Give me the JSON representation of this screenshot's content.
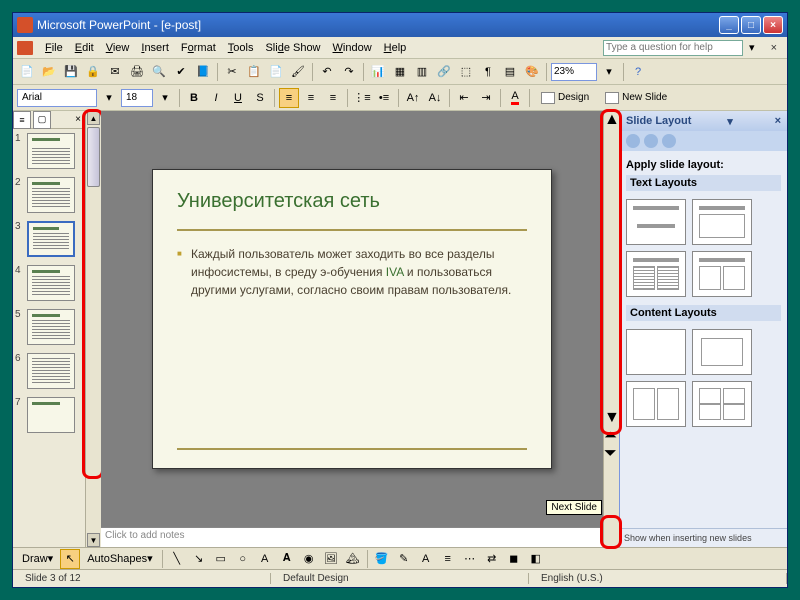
{
  "title": "Microsoft PowerPoint - [e-post]",
  "menus": [
    "File",
    "Edit",
    "View",
    "Insert",
    "Format",
    "Tools",
    "Slide Show",
    "Window",
    "Help"
  ],
  "helpPlaceholder": "Type a question for help",
  "zoom": "23%",
  "font": {
    "name": "Arial",
    "size": "18"
  },
  "designLabel": "Design",
  "newSlideLabel": "New Slide",
  "slidenums": [
    "1",
    "2",
    "3",
    "4",
    "5",
    "6",
    "7"
  ],
  "slide": {
    "title": "Университетская сеть",
    "bullet_pre": "Каждый пользователь может заходить во все разделы инфосистемы, в среду э-обучения ",
    "bullet_link": "IVA",
    "bullet_post": " и пользоваться другими услугами, согласно своим правам пользователя."
  },
  "notesPlaceholder": "Click to add notes",
  "taskpane": {
    "title": "Slide Layout",
    "apply": "Apply slide layout:",
    "section1": "Text Layouts",
    "section2": "Content Layouts",
    "footer": "Show when inserting new slides"
  },
  "tooltip": "Next Slide",
  "draw": {
    "label": "Draw",
    "autoshapes": "AutoShapes"
  },
  "status": {
    "slide": "Slide 3 of 12",
    "design": "Default Design",
    "lang": "English (U.S.)"
  }
}
